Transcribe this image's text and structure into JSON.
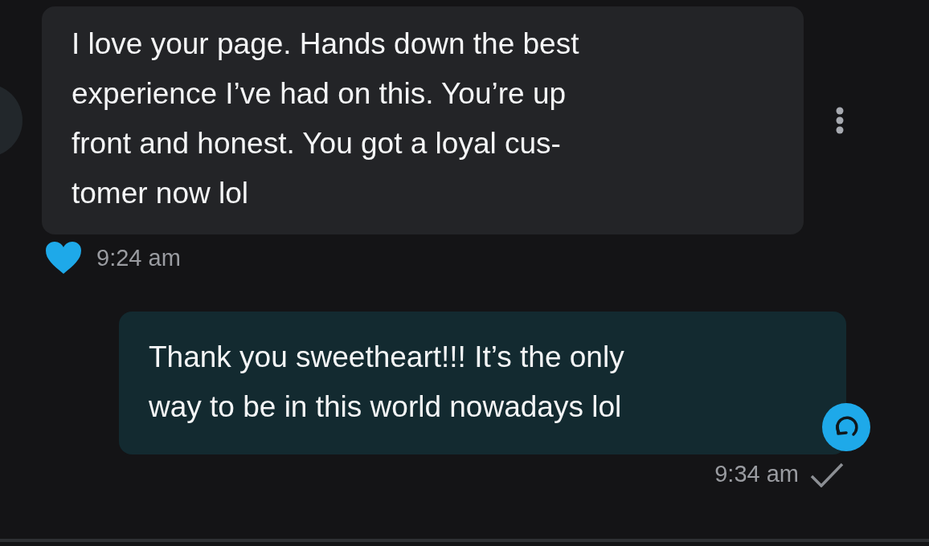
{
  "messages": [
    {
      "kind": "incoming",
      "text": "I love your page. Hands down the best\nexperience I’ve had on this. You’re up\nfront and honest. You got a loyal cus-\ntomer now lol",
      "liked": true,
      "time": "9:24 am"
    },
    {
      "kind": "outgoing",
      "text": "Thank you sweetheart!!! It’s the only\nway to be in this world nowadays lol",
      "time": "9:34 am",
      "sent": true
    }
  ]
}
